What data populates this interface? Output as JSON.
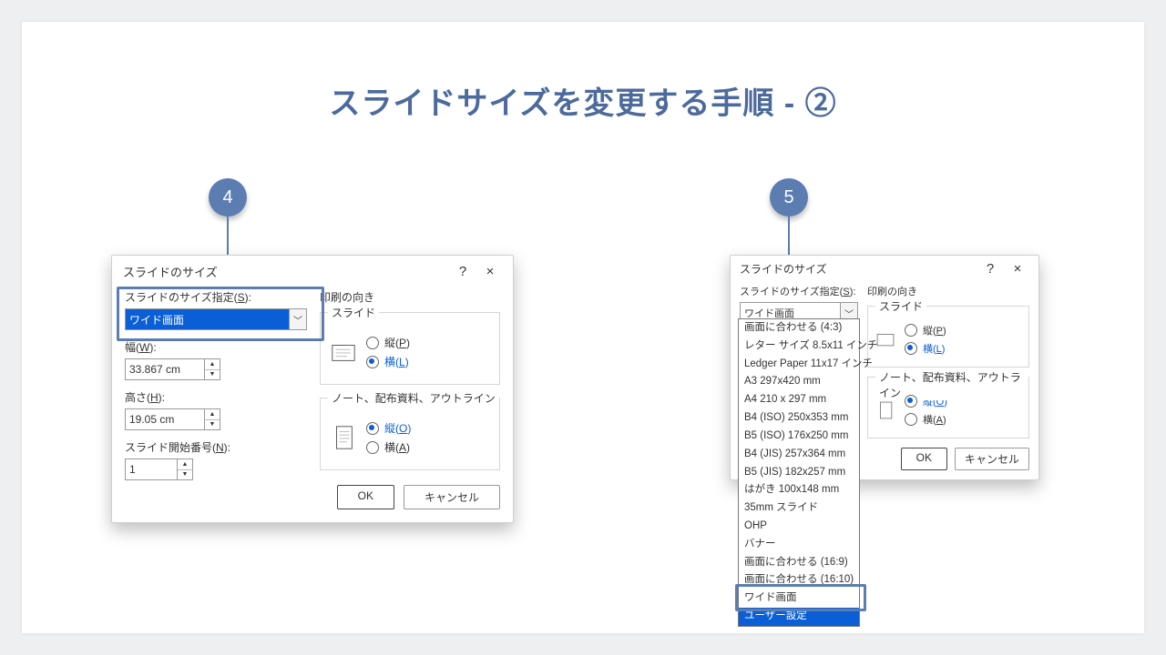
{
  "title": "スライドサイズを変更する手順 - ②",
  "badges": {
    "step4": "4",
    "step5": "5"
  },
  "dialog": {
    "title": "スライドのサイズ",
    "help": "?",
    "close": "×",
    "size_label_pre": "スライドのサイズ指定(",
    "size_label_key": "S",
    "size_label_post": "):",
    "size_value": "ワイド画面",
    "width_label_pre": "幅(",
    "width_label_key": "W",
    "width_label_post": "):",
    "width_value": "33.867 cm",
    "height_label_pre": "高さ(",
    "height_label_key": "H",
    "height_label_post": "):",
    "height_value": "19.05 cm",
    "startnum_label_pre": "スライド開始番号(",
    "startnum_label_key": "N",
    "startnum_label_post": "):",
    "startnum_value": "1",
    "orient_title": "印刷の向き",
    "orient_group1": "スライド",
    "orient_group2": "ノート、配布資料、アウトライン",
    "portrait_label_pre": "縦(",
    "portrait_key_p": "P",
    "portrait_key_o": "O",
    "portrait_label_post": ")",
    "landscape_label_pre": "横(",
    "landscape_key_l": "L",
    "landscape_key_a": "A",
    "landscape_label_post": ")",
    "ok": "OK",
    "cancel": "キャンセル"
  },
  "dropdown_options": [
    "画面に合わせる (4:3)",
    "レター サイズ 8.5x11 インチ",
    "Ledger Paper 11x17 インチ",
    "A3 297x420 mm",
    "A4 210 x 297 mm",
    "B4 (ISO) 250x353 mm",
    "B5 (ISO) 176x250 mm",
    "B4 (JIS) 257x364 mm",
    "B5 (JIS) 182x257 mm",
    "はがき 100x148 mm",
    "35mm スライド",
    "OHP",
    "バナー",
    "画面に合わせる (16:9)",
    "画面に合わせる (16:10)",
    "ワイド画面",
    "ユーザー設定"
  ]
}
